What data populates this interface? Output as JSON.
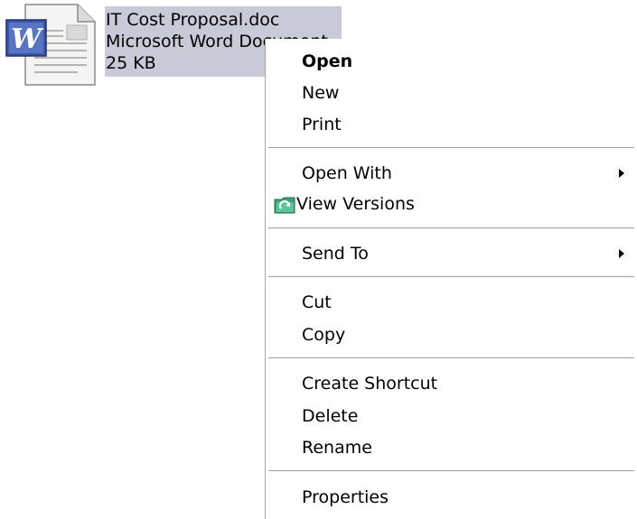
{
  "file": {
    "name": "IT Cost Proposal.doc",
    "type": "Microsoft Word Document",
    "size": "25 KB",
    "icon": "word-document-icon"
  },
  "colors": {
    "selection_bg": "#c8cad8",
    "menu_bg": "#ffffff",
    "separator": "#a0a0a0"
  },
  "menu": {
    "open": "Open",
    "new": "New",
    "print": "Print",
    "open_with": "Open With",
    "view_versions": "View Versions",
    "send_to": "Send To",
    "cut": "Cut",
    "copy": "Copy",
    "create_shortcut": "Create Shortcut",
    "delete": "Delete",
    "rename": "Rename",
    "properties": "Properties"
  }
}
